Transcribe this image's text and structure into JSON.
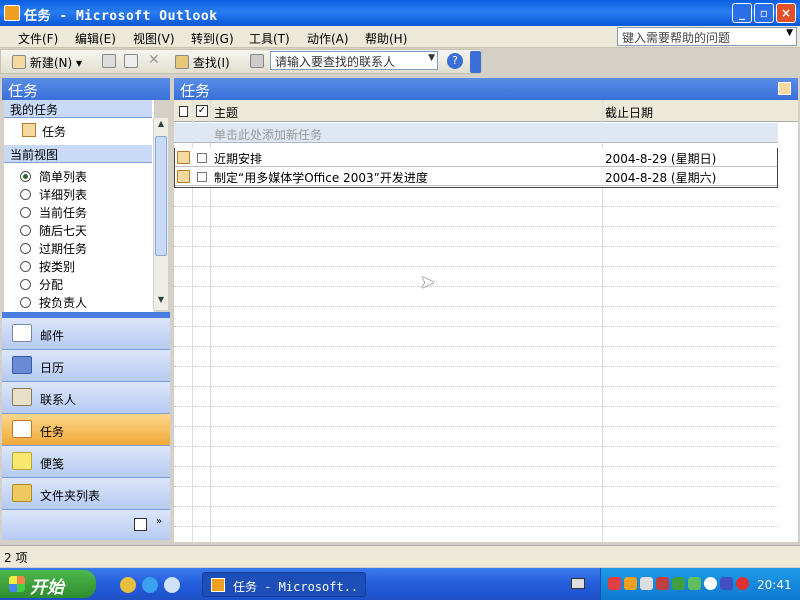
{
  "window": {
    "title": "任务 - Microsoft Outlook"
  },
  "menu": [
    "文件(F)",
    "编辑(E)",
    "视图(V)",
    "转到(G)",
    "工具(T)",
    "动作(A)",
    "帮助(H)"
  ],
  "help_box": {
    "placeholder": "键入需要帮助的问题"
  },
  "toolbar": {
    "new_label": "新建(N)",
    "find_label": "查找(I)",
    "contact_search": "请输入要查找的联系人"
  },
  "nav": {
    "header": "任务",
    "my_tasks_label": "我的任务",
    "my_tasks_item": "任务",
    "current_view_label": "当前视图",
    "views": [
      "简单列表",
      "详细列表",
      "当前任务",
      "随后七天",
      "过期任务",
      "按类别",
      "分配",
      "按负责人"
    ],
    "selected_view": "简单列表",
    "buttons": [
      "邮件",
      "日历",
      "联系人",
      "任务",
      "便笺",
      "文件夹列表"
    ],
    "active_button": "任务"
  },
  "main": {
    "header": "任务",
    "columns": {
      "subject": "主题",
      "due": "截止日期"
    },
    "new_task_placeholder": "单击此处添加新任务",
    "tasks": [
      {
        "subject": "近期安排",
        "due": "2004-8-29 (星期日)"
      },
      {
        "subject": "制定“用多媒体学Office 2003”开发进度",
        "due": "2004-8-28 (星期六)"
      }
    ]
  },
  "status": {
    "count": "2 项"
  },
  "taskbar": {
    "start": "开始",
    "window_button": "任务 - Microsoft..",
    "clock": "20:41"
  },
  "colors": {
    "title_bar": "#0a5fe0",
    "pane_header": "#3a6fd8",
    "active_nav": "#f2a83a"
  }
}
